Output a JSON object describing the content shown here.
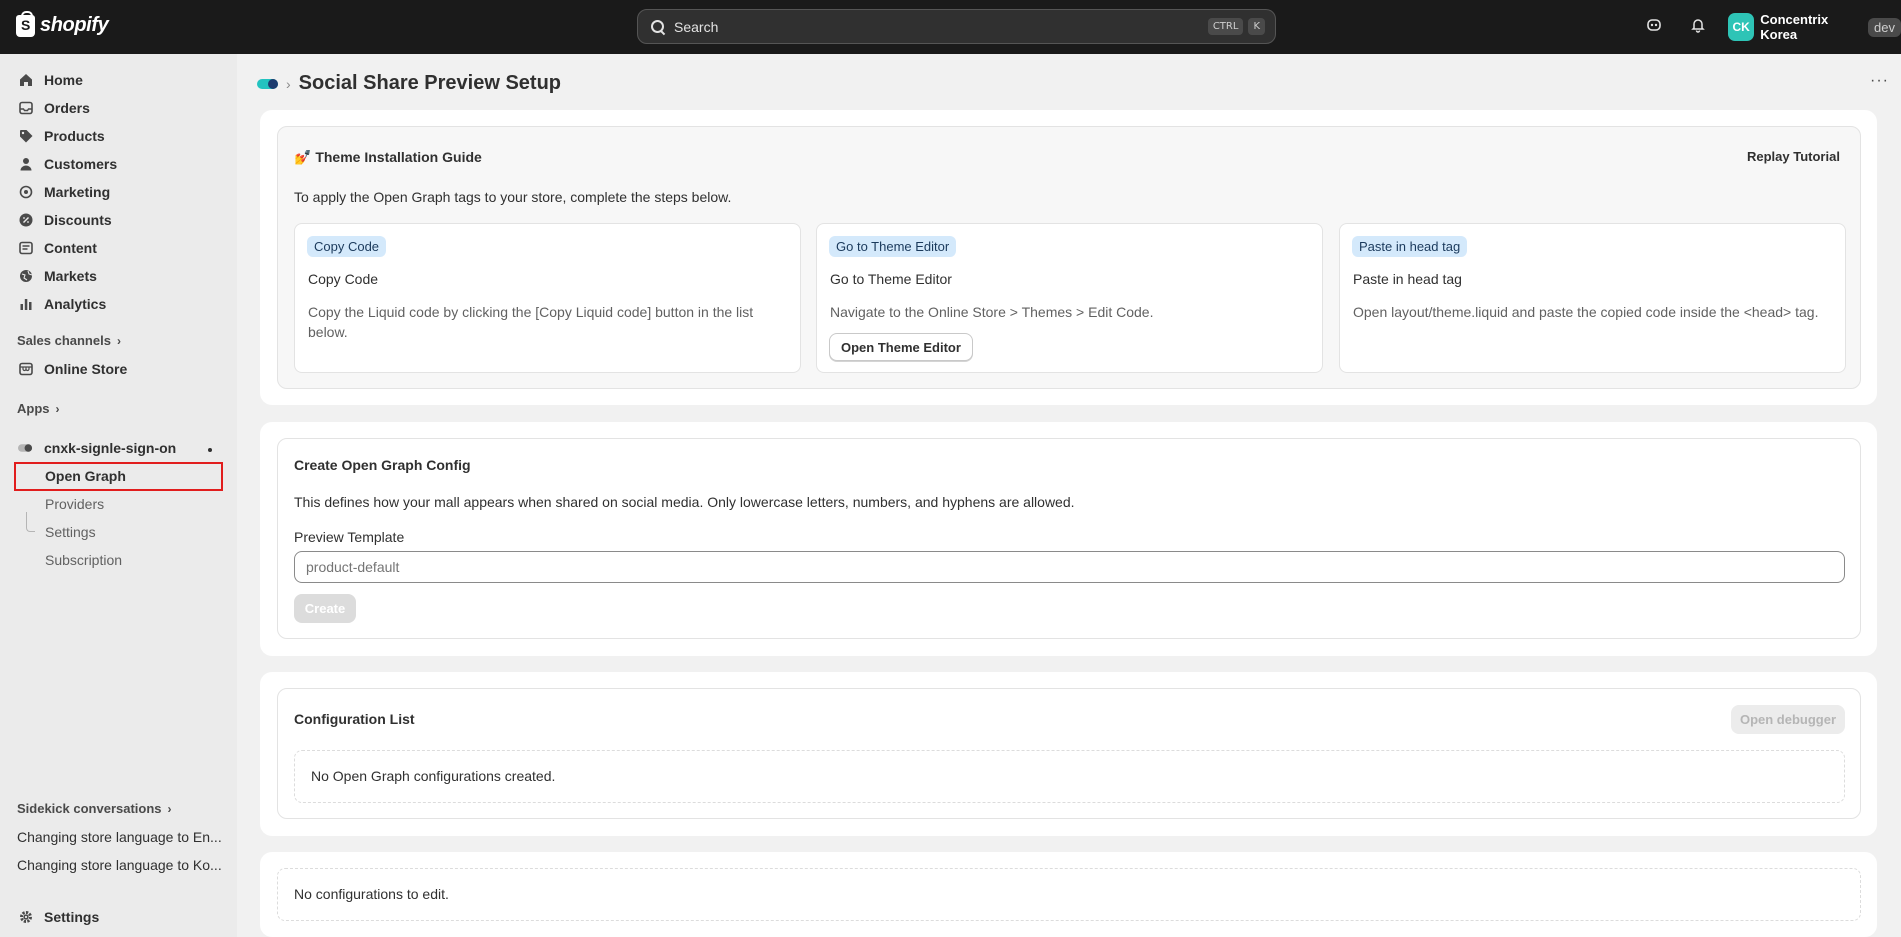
{
  "topbar": {
    "brand": "shopify",
    "search_placeholder": "Search",
    "shortcut_ctrl": "CTRL",
    "shortcut_k": "K",
    "store_initials": "CK",
    "store_name": "Concentrix Korea",
    "store_tag": "dev"
  },
  "sidebar": {
    "nav": [
      {
        "label": "Home",
        "icon": "home-icon"
      },
      {
        "label": "Orders",
        "icon": "inbox-icon"
      },
      {
        "label": "Products",
        "icon": "tag-icon"
      },
      {
        "label": "Customers",
        "icon": "person-icon"
      },
      {
        "label": "Marketing",
        "icon": "target-icon"
      },
      {
        "label": "Discounts",
        "icon": "discount-icon"
      },
      {
        "label": "Content",
        "icon": "content-icon"
      },
      {
        "label": "Markets",
        "icon": "globe-icon"
      },
      {
        "label": "Analytics",
        "icon": "chart-icon"
      }
    ],
    "sales_channels_label": "Sales channels",
    "online_store_label": "Online Store",
    "apps_label": "Apps",
    "app_name": "cnxk-signle-sign-on",
    "app_sub_items": [
      "Open Graph",
      "Providers",
      "Settings",
      "Subscription"
    ],
    "sidekick_label": "Sidekick conversations",
    "conversations": [
      "Changing store language to En...",
      "Changing store language to Ko..."
    ],
    "settings_label": "Settings"
  },
  "page": {
    "title": "Social Share Preview Setup",
    "breadcrumb_sep": "›",
    "more": "···"
  },
  "guide": {
    "emoji": "💅",
    "title": "Theme Installation Guide",
    "replay_label": "Replay Tutorial",
    "intro": "To apply the Open Graph tags to your store, complete the steps below.",
    "steps": [
      {
        "badge": "Copy Code",
        "title": "Copy Code",
        "desc": "Copy the Liquid code by clicking the [Copy Liquid code] button in the list below."
      },
      {
        "badge": "Go to Theme Editor",
        "title": "Go to Theme Editor",
        "desc": "Navigate to the Online Store > Themes > Edit Code.",
        "button": "Open Theme Editor"
      },
      {
        "badge": "Paste in head tag",
        "title": "Paste in head tag",
        "desc": "Open layout/theme.liquid and paste the copied code inside the <head> tag."
      }
    ]
  },
  "create": {
    "title": "Create Open Graph Config",
    "desc": "This defines how your mall appears when shared on social media. Only lowercase letters, numbers, and hyphens are allowed.",
    "field_label": "Preview Template",
    "placeholder": "product-default",
    "button": "Create"
  },
  "config_list": {
    "title": "Configuration List",
    "debugger_button": "Open debugger",
    "empty": "No Open Graph configurations created."
  },
  "edit": {
    "empty": "No configurations to edit."
  }
}
